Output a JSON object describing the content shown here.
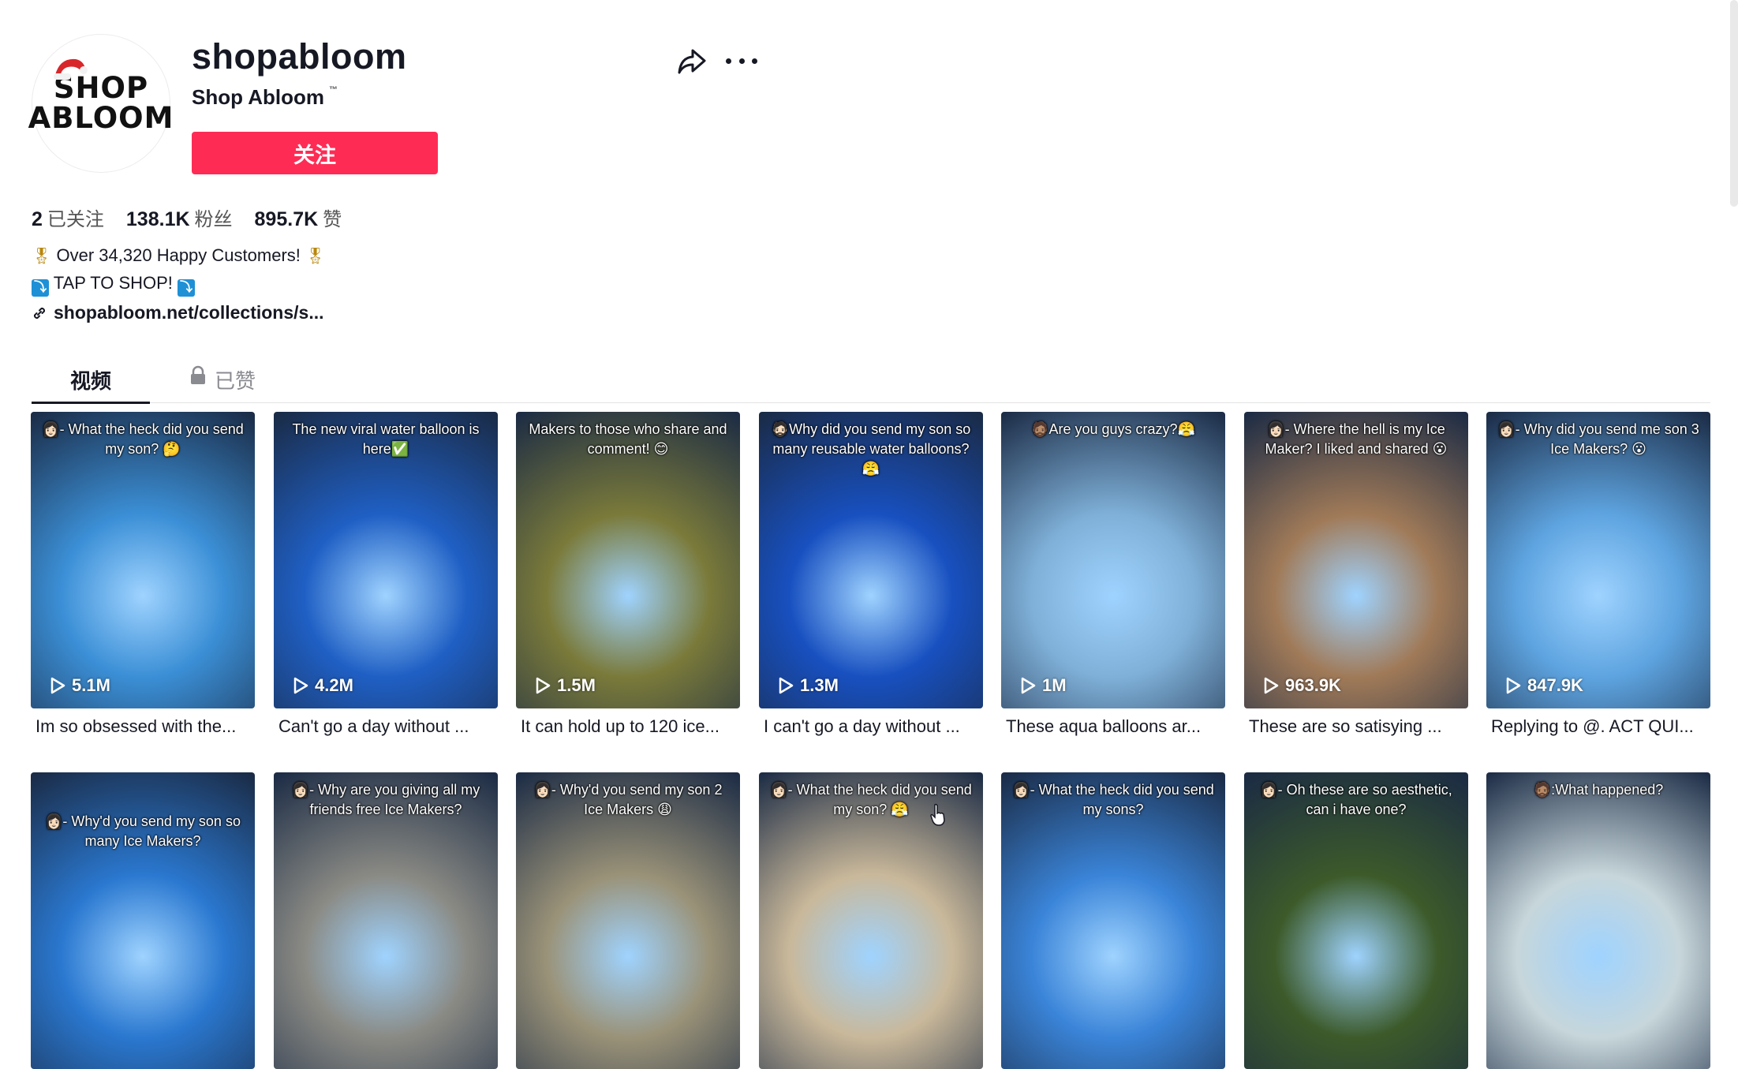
{
  "profile": {
    "avatar_text": [
      "SHOP",
      "ABLOOM"
    ],
    "username": "shopabloom",
    "nickname": "Shop Abloom",
    "nickname_mark": "™",
    "follow_label": "关注"
  },
  "stats": {
    "following_num": "2",
    "following_label": "已关注",
    "followers_num": "138.1K",
    "followers_label": "粉丝",
    "likes_num": "895.7K",
    "likes_label": "赞"
  },
  "bio": {
    "line1": "Over 34,320 Happy Customers!",
    "line2": "TAP TO SHOP!",
    "medal_icon": "🎖",
    "arrow_icon": "⤵"
  },
  "link": {
    "text": "shopabloom.net/collections/s..."
  },
  "tabs": {
    "videos": "视频",
    "liked": "已赞"
  },
  "videos": [
    {
      "overlay": "👩🏻- What the heck did you send my son? 🤔",
      "views": "5.1M",
      "caption": "Im so obsessed with the...",
      "bg": "#3b8fd6"
    },
    {
      "overlay": "The new viral water balloon is here✅",
      "views": "4.2M",
      "caption": "Can't go a day without ...",
      "bg": "#1f5fc4"
    },
    {
      "overlay": "Makers to those who share and comment! 😊",
      "views": "1.5M",
      "caption": "It can hold up to 120 ice...",
      "bg": "#7a7a3a"
    },
    {
      "overlay": "🧔🏻Why did you send my son so many reusable water balloons?😤",
      "views": "1.3M",
      "caption": "I can't go a day without ...",
      "bg": "#1850c0"
    },
    {
      "overlay": "🧔🏽Are you guys crazy?😤",
      "views": "1M",
      "caption": "These aqua balloons ar...",
      "bg": "#7fb0d8"
    },
    {
      "overlay": "👩🏻- Where the hell is my Ice Maker? I liked and shared 😮",
      "views": "963.9K",
      "caption": "These are so satisying ...",
      "bg": "#a07a58"
    },
    {
      "overlay": "👩🏻- Why did you send me son 3 Ice Makers? 😮",
      "views": "847.9K",
      "caption": "Replying to @. ACT QUI...",
      "bg": "#5ea4e0"
    },
    {
      "overlay": "👩🏻- Why'd you send my son so many Ice Makers?",
      "views": "",
      "caption": "",
      "bg": "#2a78d0"
    },
    {
      "overlay": "👩🏻- Why are you giving all my friends free Ice Makers?",
      "views": "",
      "caption": "",
      "bg": "#8a8a84"
    },
    {
      "overlay": "👩🏻- Why'd you send my son 2 Ice Makers 😩",
      "views": "",
      "caption": "",
      "bg": "#9a9278"
    },
    {
      "overlay": "👩🏻- What the heck did you send my son? 😤",
      "views": "",
      "caption": "",
      "bg": "#c9b89a"
    },
    {
      "overlay": "👩🏻- What the heck did you send my sons?",
      "views": "",
      "caption": "",
      "bg": "#3a84d8"
    },
    {
      "overlay": "👩🏻- Oh these are so aesthetic, can i have one?",
      "views": "",
      "caption": "",
      "bg": "#3c5a2a"
    },
    {
      "overlay": "🧔🏽:What happened?",
      "views": "",
      "caption": "",
      "bg": "#c7d6da"
    }
  ],
  "colors": {
    "accent": "#fe2c55"
  },
  "icons": {
    "share": "share-icon",
    "more": "more-icon",
    "link": "link-icon",
    "lock": "lock-icon",
    "play": "play-icon"
  }
}
